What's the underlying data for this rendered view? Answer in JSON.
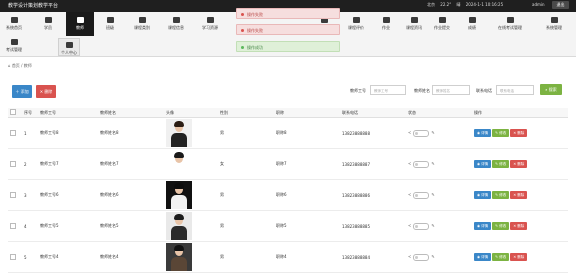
{
  "topbar": {
    "brand": "教学设计策划教学平台",
    "weather": "北京",
    "temp": "22.2°",
    "weather_desc": "晴",
    "datetime": "2024-1-1 10:16:25",
    "user": "admin",
    "logout": "退出"
  },
  "nav": {
    "row1": [
      {
        "label": "系统首页"
      },
      {
        "label": "学员"
      },
      {
        "label": "教师"
      },
      {
        "label": "班级"
      },
      {
        "label": "课程类别"
      },
      {
        "label": "课程信息"
      },
      {
        "label": "学习资源"
      },
      {
        "label": "课程"
      },
      {
        "label": "课程评价"
      },
      {
        "label": "作业"
      },
      {
        "label": "课程资讯"
      },
      {
        "label": "作业提交"
      },
      {
        "label": "成绩"
      },
      {
        "label": "在线考试管理"
      },
      {
        "label": "系统管理"
      }
    ],
    "row2": [
      {
        "label": "考试管理"
      },
      {
        "label": "个人中心"
      }
    ]
  },
  "toasts": [
    {
      "type": "err",
      "text": "操作失败"
    },
    {
      "type": "err",
      "text": "操作失败"
    },
    {
      "type": "ok",
      "text": "操作成功"
    }
  ],
  "breadcrumb": "首页 / 教师",
  "actions": {
    "add": "添加",
    "delete": "删除"
  },
  "filters": {
    "f1_label": "教师工号",
    "f1_placeholder": "教师工号",
    "f2_label": "教师姓名",
    "f2_placeholder": "教师姓名",
    "f3_label": "联系电话",
    "f3_placeholder": "联系电话",
    "search": "搜索"
  },
  "table": {
    "headers": [
      "",
      "序号",
      "教师工号",
      "教师姓名",
      "头像",
      "性别",
      "职称",
      "联系电话",
      "状态",
      "操作"
    ],
    "rows": [
      {
        "index": "1",
        "id": "教师工号8",
        "name": "教师姓名8",
        "gender": "男",
        "title": "职称8",
        "phone": "13823888888",
        "photo": {
          "bg": "#f0f0f0",
          "hair": "#2b1d14",
          "body": "#222222"
        }
      },
      {
        "index": "2",
        "id": "教师工号7",
        "name": "教师姓名7",
        "gender": "女",
        "title": "职称7",
        "phone": "13823888887",
        "photo": {
          "bg": "#ffffff",
          "hair": "#1a1a1a",
          "body": "#ffffff"
        }
      },
      {
        "index": "3",
        "id": "教师工号6",
        "name": "教师姓名6",
        "gender": "男",
        "title": "职称6",
        "phone": "13823888886",
        "photo": {
          "bg": "#111111",
          "hair": "#0d0d0d",
          "body": "#f2f2f2"
        }
      },
      {
        "index": "4",
        "id": "教师工号5",
        "name": "教师姓名5",
        "gender": "男",
        "title": "职称5",
        "phone": "13823888885",
        "photo": {
          "bg": "#e9e9e9",
          "hair": "#1c1c1c",
          "body": "#2a2a2a"
        }
      },
      {
        "index": "5",
        "id": "教师工号4",
        "name": "教师姓名4",
        "gender": "男",
        "title": "职称4",
        "phone": "13823888884",
        "photo": {
          "bg": "#3a3a3a",
          "hair": "#121212",
          "body": "#5a4636"
        }
      }
    ],
    "ops": {
      "view": "详情",
      "edit": "修改",
      "del": "删除"
    }
  }
}
